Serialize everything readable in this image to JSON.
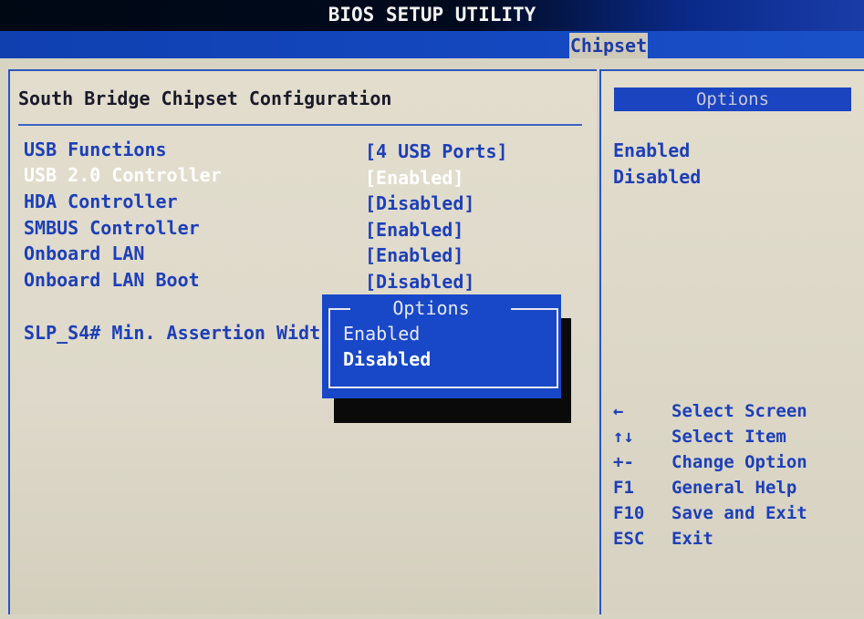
{
  "title": "BIOS SETUP UTILITY",
  "tabs": [
    {
      "label": "Chipset",
      "active": true
    }
  ],
  "section_title": "South Bridge Chipset Configuration",
  "settings": [
    {
      "label": "USB Functions",
      "value": "[4 USB Ports]"
    },
    {
      "label": "USB 2.0 Controller",
      "value": "[Enabled]",
      "selected": true
    },
    {
      "label": "HDA Controller",
      "value": "[Disabled]"
    },
    {
      "label": "SMBUS Controller",
      "value": "[Enabled]"
    },
    {
      "label": "Onboard LAN",
      "value": "[Enabled]"
    },
    {
      "label": "Onboard LAN Boot",
      "value": "[Disabled]"
    },
    {
      "label": "SLP_S4# Min. Assertion Widt",
      "value": ""
    }
  ],
  "help_panel": {
    "header": "Options",
    "options": [
      "Enabled",
      "Disabled"
    ]
  },
  "key_help": [
    {
      "key": "←",
      "desc": "Select Screen"
    },
    {
      "key": "↑↓",
      "desc": "Select Item"
    },
    {
      "key": "+-",
      "desc": "Change Option"
    },
    {
      "key": "F1",
      "desc": "General Help"
    },
    {
      "key": "F10",
      "desc": "Save and Exit"
    },
    {
      "key": "ESC",
      "desc": "Exit"
    }
  ],
  "popup": {
    "title": "Options",
    "options": [
      "Enabled",
      "Disabled"
    ],
    "highlighted": "Disabled"
  },
  "colors": {
    "background": "#d8d4c4",
    "label_blue": "#1d3fb8",
    "popup_blue": "#1848c8",
    "selected_text": "#ffffff"
  }
}
